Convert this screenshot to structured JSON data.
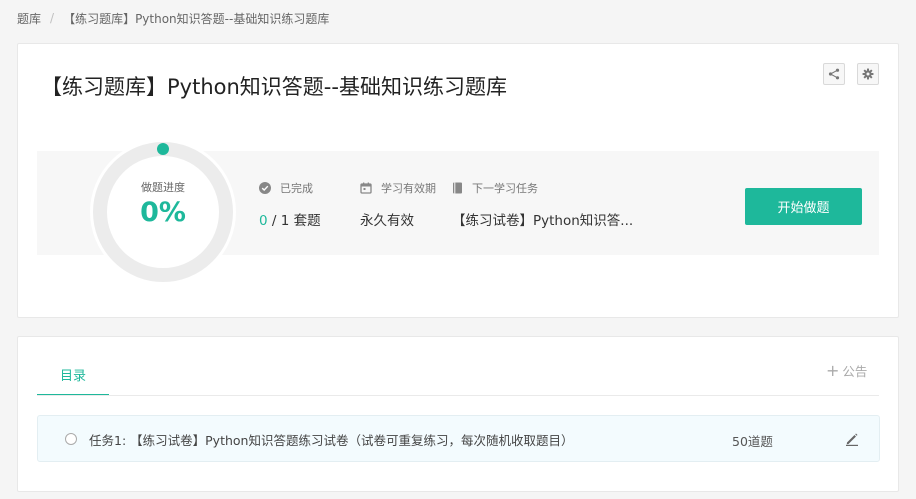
{
  "breadcrumb": {
    "root": "题库",
    "separator": "/",
    "current": "【练习题库】Python知识答题--基础知识练习题库"
  },
  "header": {
    "title": "【练习题库】Python知识答题--基础知识练习题库",
    "share_icon": "share-icon",
    "settings_icon": "gear-icon"
  },
  "progress": {
    "label": "做题进度",
    "value_text": "0%",
    "fraction": 0.0,
    "accent_color": "#1eb89b"
  },
  "stats": {
    "completed": {
      "icon": "check-circle-icon",
      "label": "已完成",
      "done": "0",
      "total_text": " / 1 套题"
    },
    "validity": {
      "icon": "calendar-icon",
      "label": "学习有效期",
      "value": "永久有效"
    },
    "next_task": {
      "icon": "book-icon",
      "label": "下一学习任务",
      "value": "【练习试卷】Python知识答..."
    }
  },
  "start_button": {
    "label": "开始做题"
  },
  "catalog": {
    "tab_label": "目录",
    "notice_plus": "+",
    "notice_label": "公告",
    "tasks": [
      {
        "title": "任务1: 【练习试卷】Python知识答题练习试卷（试卷可重复练习，每次随机收取题目）",
        "count": "50道题",
        "edit_icon": "pencil-icon"
      }
    ]
  }
}
